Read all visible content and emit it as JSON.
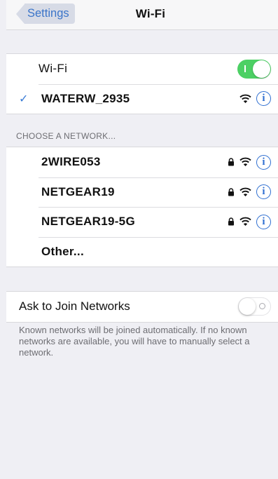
{
  "nav": {
    "back_label": "Settings",
    "title": "Wi-Fi"
  },
  "wifi": {
    "label": "Wi-Fi",
    "toggle_on": true
  },
  "connected": {
    "name": "WATERW_2935"
  },
  "section_header": "CHOOSE A NETWORK...",
  "networks": [
    {
      "name": "2WIRE053",
      "locked": true
    },
    {
      "name": "NETGEAR19",
      "locked": true
    },
    {
      "name": "NETGEAR19-5G",
      "locked": true
    }
  ],
  "other_label": "Other...",
  "ask": {
    "label": "Ask to Join Networks",
    "toggle_on": false
  },
  "footnote": "Known networks will be joined automatically. If no known networks are available, you will have to manually select a network.",
  "colors": {
    "accent": "#2f6fd1",
    "toggle_on": "#4cd064",
    "background": "#efeff4"
  }
}
